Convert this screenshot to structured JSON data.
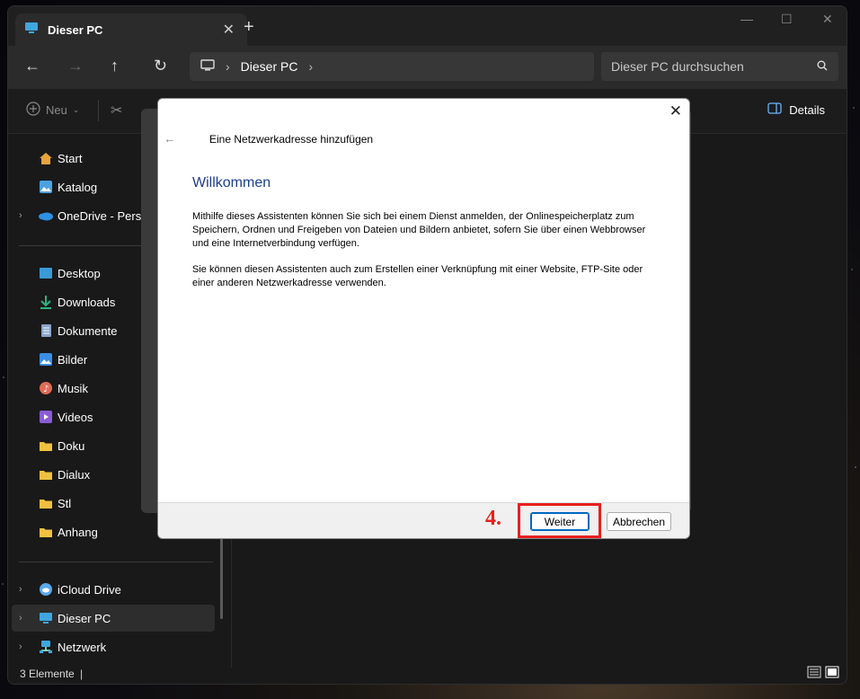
{
  "window": {
    "tab_title": "Dieser PC",
    "new_tab": "+",
    "address": {
      "location": "Dieser PC"
    },
    "search": {
      "placeholder": "Dieser PC durchsuchen"
    },
    "toolbar": {
      "new_label": "Neu",
      "details_label": "Details"
    }
  },
  "sidebar": {
    "quick": [
      {
        "label": "Start",
        "icon": "home-icon",
        "color": "#e8a33c"
      },
      {
        "label": "Katalog",
        "icon": "gallery-icon",
        "color": "#4aa3df"
      },
      {
        "label": "OneDrive - Persona",
        "icon": "onedrive-icon",
        "color": "#2f8fe3",
        "expandable": true
      }
    ],
    "pinned": [
      {
        "label": "Desktop",
        "icon": "desktop-icon",
        "color": "#3a9bd6"
      },
      {
        "label": "Downloads",
        "icon": "download-icon",
        "color": "#2ab57d"
      },
      {
        "label": "Dokumente",
        "icon": "document-icon",
        "color": "#8aa4c8"
      },
      {
        "label": "Bilder",
        "icon": "pictures-icon",
        "color": "#3a8ee6"
      },
      {
        "label": "Musik",
        "icon": "music-icon",
        "color": "#e06b54"
      },
      {
        "label": "Videos",
        "icon": "videos-icon",
        "color": "#8a5cd6"
      },
      {
        "label": "Doku",
        "icon": "folder-icon",
        "color": "#f0c040"
      },
      {
        "label": "Dialux",
        "icon": "folder-icon",
        "color": "#f0c040"
      },
      {
        "label": "Stl",
        "icon": "folder-icon",
        "color": "#f0c040"
      },
      {
        "label": "Anhang",
        "icon": "folder-icon",
        "color": "#f0c040"
      }
    ],
    "drives": [
      {
        "label": "iCloud Drive",
        "icon": "icloud-icon",
        "color": "#5aa8e8",
        "expandable": true
      },
      {
        "label": "Dieser PC",
        "icon": "computer-icon",
        "color": "#3fa7e0",
        "expandable": true,
        "selected": true
      },
      {
        "label": "Netzwerk",
        "icon": "network-icon",
        "color": "#3fa7e0",
        "expandable": true
      }
    ]
  },
  "status": {
    "count": "3 Elemente"
  },
  "dialog": {
    "title": "Eine Netzwerkadresse hinzufügen",
    "heading": "Willkommen",
    "paragraph1": "Mithilfe dieses Assistenten können Sie sich bei einem Dienst anmelden, der Onlinespeicherplatz zum Speichern, Ordnen und Freigeben von Dateien und Bildern anbietet, sofern Sie über einen Webbrowser und eine Internetverbindung verfügen.",
    "paragraph2": "Sie können diesen Assistenten auch zum Erstellen einer Verknüpfung mit einer Website, FTP-Site oder einer anderen Netzwerkadresse verwenden.",
    "next_label": "Weiter",
    "cancel_label": "Abbrechen",
    "annotation": "4.",
    "annotation_color": "#e8201e"
  }
}
